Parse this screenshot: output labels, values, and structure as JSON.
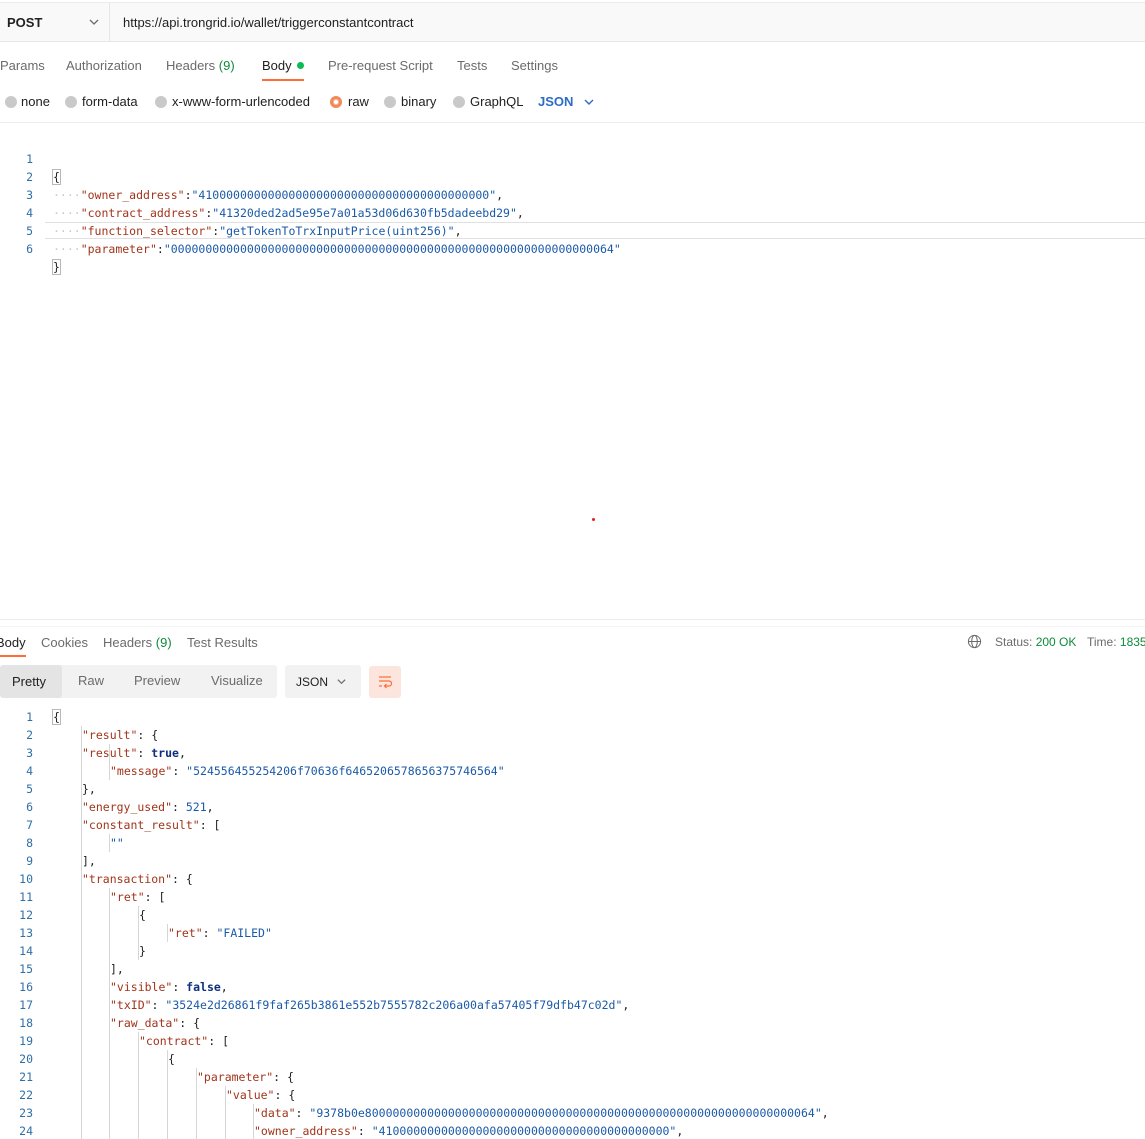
{
  "request": {
    "method": "POST",
    "url": "https://api.trongrid.io/wallet/triggerconstantcontract"
  },
  "request_tabs": [
    {
      "label": "Params"
    },
    {
      "label": "Authorization"
    },
    {
      "label": "Headers",
      "count": "(9)"
    },
    {
      "label": "Body"
    },
    {
      "label": "Pre-request Script"
    },
    {
      "label": "Tests"
    },
    {
      "label": "Settings"
    }
  ],
  "body_types": [
    "none",
    "form-data",
    "x-www-form-urlencoded",
    "raw",
    "binary",
    "GraphQL"
  ],
  "body_type_selected": "raw",
  "body_format": "JSON",
  "request_body": {
    "line_numbers": [
      "1",
      "2",
      "3",
      "4",
      "5",
      "6"
    ],
    "open": "{",
    "close": "}",
    "fields": [
      {
        "key": "\"owner_address\"",
        "value": "\"410000000000000000000000000000000000000000\"",
        "comma": ","
      },
      {
        "key": "\"contract_address\"",
        "value": "\"41320ded2ad5e95e7a01a53d06d630fb5dadeebd29\"",
        "comma": ","
      },
      {
        "key": "\"function_selector\"",
        "value": "\"getTokenToTrxInputPrice(uint256)\"",
        "comma": ","
      },
      {
        "key": "\"parameter\"",
        "value": "\"0000000000000000000000000000000000000000000000000000000000000064\"",
        "comma": ""
      }
    ]
  },
  "response_tabs": [
    {
      "label": "Body"
    },
    {
      "label": "Cookies"
    },
    {
      "label": "Headers",
      "count": "(9)"
    },
    {
      "label": "Test Results"
    }
  ],
  "status": {
    "label": "Status:",
    "value": "200 OK"
  },
  "time": {
    "label": "Time:",
    "value": "1835"
  },
  "view_modes": [
    "Pretty",
    "Raw",
    "Preview",
    "Visualize"
  ],
  "response_format": "JSON",
  "response_lines": [
    {
      "n": "1",
      "t": [
        [
          "p",
          "{"
        ]
      ]
    },
    {
      "n": "2",
      "t": [
        [
          "k",
          "\"result\""
        ],
        [
          "p",
          ": {"
        ]
      ]
    },
    {
      "n": "3",
      "t": [
        [
          "k",
          "\"result\""
        ],
        [
          "p",
          ": "
        ],
        [
          "b",
          "true"
        ],
        [
          "p",
          ","
        ]
      ]
    },
    {
      "n": "4",
      "t": [
        [
          "k",
          "\"message\""
        ],
        [
          "p",
          ": "
        ],
        [
          "s",
          "\"524556455254206f70636f6465206578656375746564\""
        ]
      ]
    },
    {
      "n": "5",
      "t": [
        [
          "p",
          "},"
        ]
      ]
    },
    {
      "n": "6",
      "t": [
        [
          "k",
          "\"energy_used\""
        ],
        [
          "p",
          ": "
        ],
        [
          "n",
          "521"
        ],
        [
          "p",
          ","
        ]
      ]
    },
    {
      "n": "7",
      "t": [
        [
          "k",
          "\"constant_result\""
        ],
        [
          "p",
          ": ["
        ]
      ]
    },
    {
      "n": "8",
      "t": [
        [
          "s",
          "\"\""
        ]
      ]
    },
    {
      "n": "9",
      "t": [
        [
          "p",
          "],"
        ]
      ]
    },
    {
      "n": "10",
      "t": [
        [
          "k",
          "\"transaction\""
        ],
        [
          "p",
          ": {"
        ]
      ]
    },
    {
      "n": "11",
      "t": [
        [
          "k",
          "\"ret\""
        ],
        [
          "p",
          ": ["
        ]
      ]
    },
    {
      "n": "12",
      "t": [
        [
          "p",
          "{"
        ]
      ]
    },
    {
      "n": "13",
      "t": [
        [
          "k",
          "\"ret\""
        ],
        [
          "p",
          ": "
        ],
        [
          "s",
          "\"FAILED\""
        ]
      ]
    },
    {
      "n": "14",
      "t": [
        [
          "p",
          "}"
        ]
      ]
    },
    {
      "n": "15",
      "t": [
        [
          "p",
          "],"
        ]
      ]
    },
    {
      "n": "16",
      "t": [
        [
          "k",
          "\"visible\""
        ],
        [
          "p",
          ": "
        ],
        [
          "b",
          "false"
        ],
        [
          "p",
          ","
        ]
      ]
    },
    {
      "n": "17",
      "t": [
        [
          "k",
          "\"txID\""
        ],
        [
          "p",
          ": "
        ],
        [
          "s",
          "\"3524e2d26861f9faf265b3861e552b7555782c206a00afa57405f79dfb47c02d\""
        ],
        [
          "p",
          ","
        ]
      ]
    },
    {
      "n": "18",
      "t": [
        [
          "k",
          "\"raw_data\""
        ],
        [
          "p",
          ": {"
        ]
      ]
    },
    {
      "n": "19",
      "t": [
        [
          "k",
          "\"contract\""
        ],
        [
          "p",
          ": ["
        ]
      ]
    },
    {
      "n": "20",
      "t": [
        [
          "p",
          "{"
        ]
      ]
    },
    {
      "n": "21",
      "t": [
        [
          "k",
          "\"parameter\""
        ],
        [
          "p",
          ": {"
        ]
      ]
    },
    {
      "n": "22",
      "t": [
        [
          "k",
          "\"value\""
        ],
        [
          "p",
          ": {"
        ]
      ]
    },
    {
      "n": "23",
      "t": [
        [
          "k",
          "\"data\""
        ],
        [
          "p",
          ": "
        ],
        [
          "s",
          "\"9378b0e80000000000000000000000000000000000000000000000000000000000000064\""
        ],
        [
          "p",
          ","
        ]
      ]
    },
    {
      "n": "24",
      "t": [
        [
          "k",
          "\"owner_address\""
        ],
        [
          "p",
          ": "
        ],
        [
          "s",
          "\"410000000000000000000000000000000000000000\""
        ],
        [
          "p",
          ","
        ]
      ]
    }
  ],
  "icons": {
    "method_dropdown": "chevron-down-icon",
    "format_dropdown": "chevron-down-icon",
    "network": "globe-icon",
    "wrap": "wrap-lines-icon"
  },
  "colors": {
    "accent": "#ff6c37",
    "link_blue": "#2d6cc6",
    "success_green": "#0f8a3c",
    "json_key": "#a3341a",
    "json_string": "#1b5aa8"
  }
}
